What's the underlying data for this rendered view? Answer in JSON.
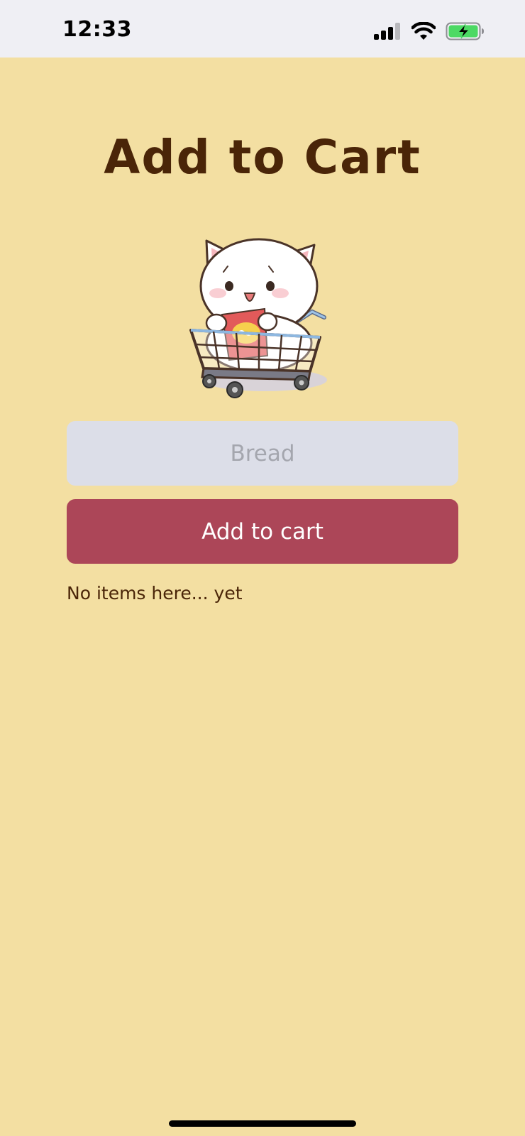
{
  "status_bar": {
    "time": "12:33",
    "icons": [
      "signal-icon",
      "wifi-icon",
      "battery-charging-icon"
    ]
  },
  "main": {
    "title": "Add to Cart",
    "mascot": "cat-in-shopping-cart-icon",
    "input": {
      "placeholder": "Bread",
      "value": ""
    },
    "add_button_label": "Add to cart",
    "empty_message": "No items here... yet"
  },
  "colors": {
    "background": "#F3DFA2",
    "title_text": "#4A2508",
    "input_background": "#DCDEE8",
    "button_background": "#AC4658",
    "button_text": "#FFFFFF",
    "status_bar_background": "#EFEFF4"
  }
}
